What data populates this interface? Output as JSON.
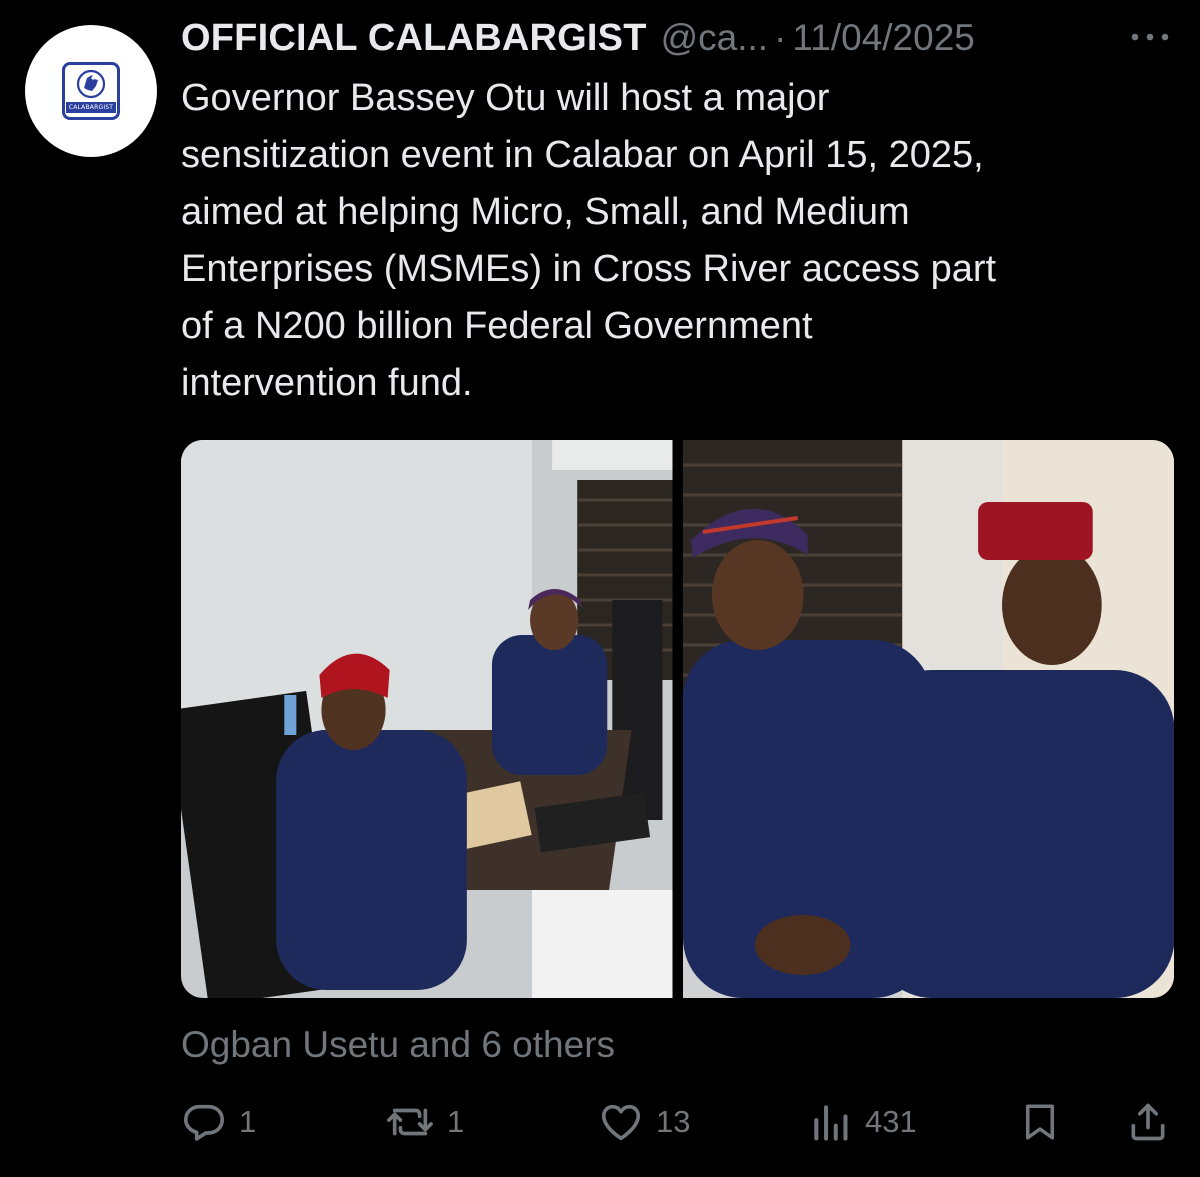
{
  "tweet": {
    "avatar_logo_text": "CALABARGIST",
    "display_name": "OFFICIAL CALABARGIST",
    "handle": "@ca...",
    "separator": "·",
    "date": "11/04/2025",
    "more_icon": "more-horizontal-icon",
    "text": "Governor Bassey Otu will host a major\nsensitization event in Calabar on April 15, 2025,\naimed at helping Micro, Small, and Medium\nEnterprises (MSMEs) in Cross River access part\nof a N200 billion Federal Government\nintervention fund.",
    "liked_by": "Ogban Usetu and 6 others"
  },
  "actions": {
    "reply": {
      "icon": "reply-icon",
      "count": "1"
    },
    "retweet": {
      "icon": "retweet-icon",
      "count": "1"
    },
    "like": {
      "icon": "heart-icon",
      "count": "13"
    },
    "views": {
      "icon": "views-icon",
      "count": "431"
    },
    "bookmark": {
      "icon": "bookmark-icon"
    },
    "share": {
      "icon": "share-icon"
    }
  },
  "colors": {
    "background": "#000000",
    "text_primary": "#e7e9ea",
    "text_secondary": "#71767b",
    "logo_blue": "#2a3f9e"
  }
}
